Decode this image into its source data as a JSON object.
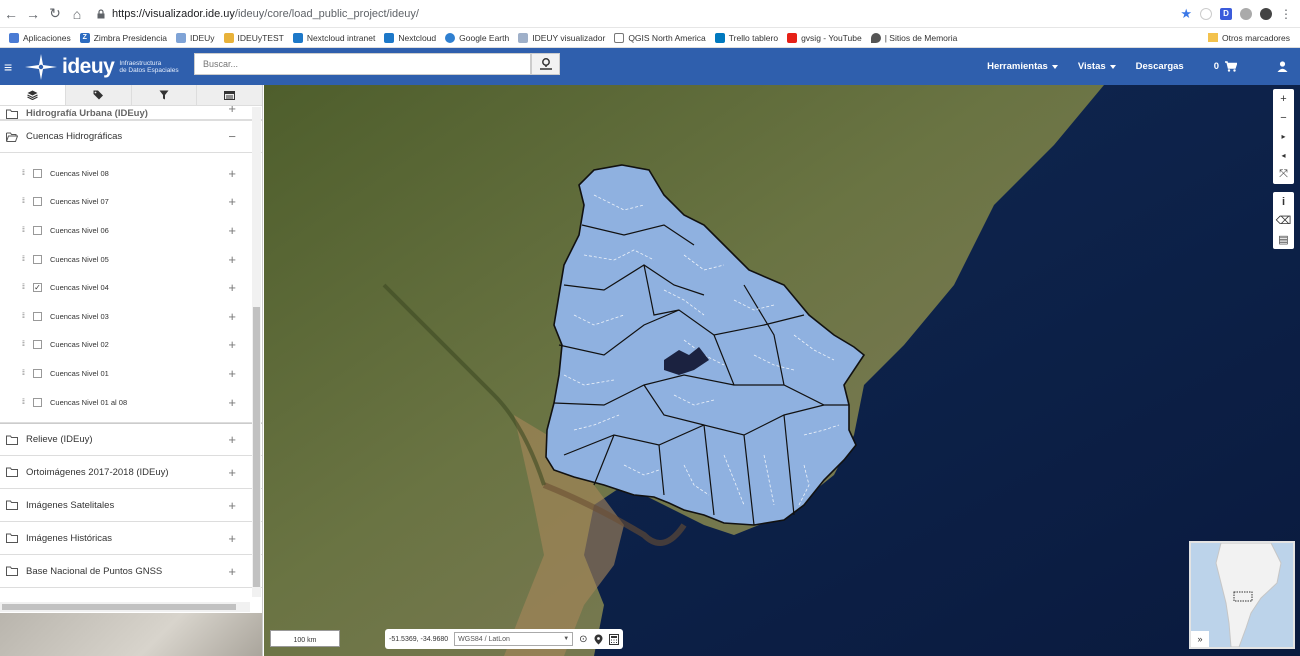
{
  "browser": {
    "url_host": "https://visualizador.ide.uy",
    "url_path": "/ideuy/core/load_public_project/ideuy/",
    "bookmarks": [
      "Aplicaciones",
      "Zimbra Presidencia",
      "IDEUy",
      "IDEUyTEST",
      "Nextcloud intranet",
      "Nextcloud",
      "Google Earth",
      "IDEUY visualizador",
      "QGIS North America",
      "Trello tablero",
      "gvsig - YouTube",
      "| Sitios de Memoria",
      "Otros marcadores"
    ]
  },
  "header": {
    "logo_text": "ideuy",
    "logo_sub_1": "Infraestructura",
    "logo_sub_2": "de Datos Espaciales",
    "search_placeholder": "Buscar...",
    "menu": [
      "Herramientas",
      "Vistas",
      "Descargas"
    ],
    "cart_count": "0"
  },
  "sidebar": {
    "top_group": "Hidrografía Urbana (IDEuy)",
    "open_group": "Cuencas Hidrográficas",
    "layers": [
      {
        "label": "Cuencas Nivel 08",
        "checked": false
      },
      {
        "label": "Cuencas Nivel 07",
        "checked": false
      },
      {
        "label": "Cuencas Nivel 06",
        "checked": false
      },
      {
        "label": "Cuencas Nivel 05",
        "checked": false
      },
      {
        "label": "Cuencas Nivel 04",
        "checked": true
      },
      {
        "label": "Cuencas Nivel 03",
        "checked": false
      },
      {
        "label": "Cuencas Nivel 02",
        "checked": false
      },
      {
        "label": "Cuencas Nivel 01",
        "checked": false
      },
      {
        "label": "Cuencas Nivel 01 al 08",
        "checked": false
      }
    ],
    "groups": [
      "Relieve (IDEuy)",
      "Ortoimágenes 2017-2018 (IDEuy)",
      "Imágenes Satelitales",
      "Imágenes Históricas",
      "Base Nacional de Puntos GNSS"
    ]
  },
  "map": {
    "scale": "100 km",
    "coords": "-51.5369, -34.9680",
    "projection": "WGS84 / LatLon",
    "overview_toggle": "»"
  }
}
